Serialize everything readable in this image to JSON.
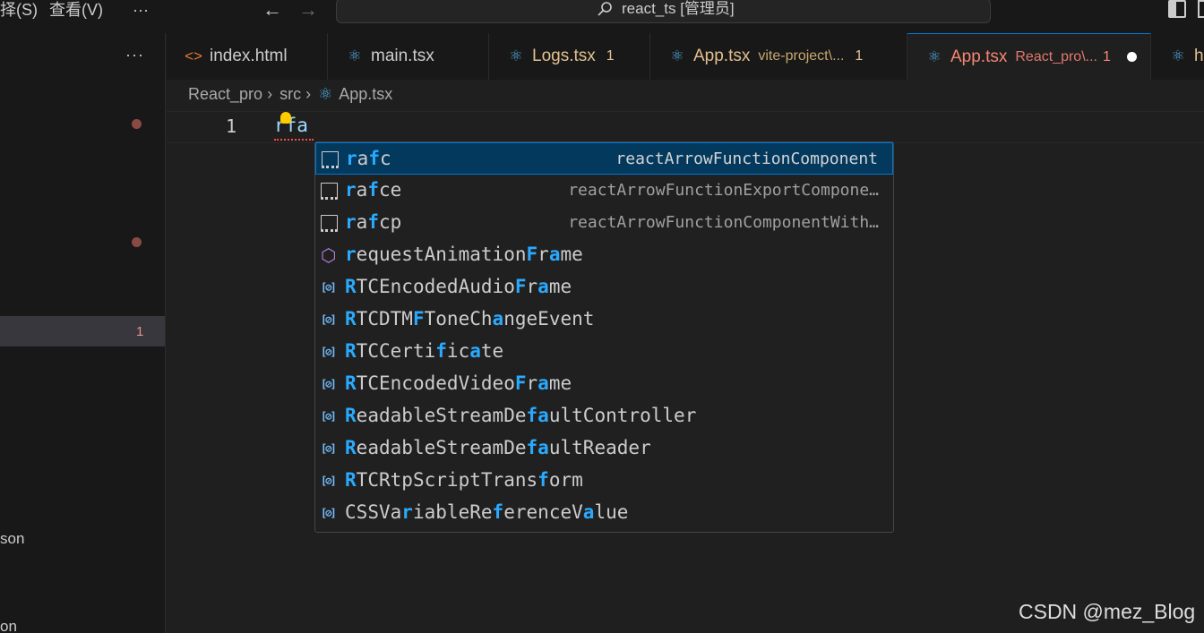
{
  "titlebar": {
    "menu_items": [
      "择(S)",
      "查看(V)",
      "···"
    ],
    "search_text": "react_ts [管理员]"
  },
  "sidebar": {
    "more_label": "···",
    "selected_count": "1",
    "partial_texts": [
      "son",
      "on"
    ]
  },
  "tabs": [
    {
      "icon": "html-icon",
      "label": "index.html",
      "desc": "",
      "badge": "",
      "color": "#cccccc"
    },
    {
      "icon": "react-icon",
      "label": "main.tsx",
      "desc": "",
      "badge": "",
      "color": "#cccccc"
    },
    {
      "icon": "react-icon",
      "label": "Logs.tsx",
      "desc": "",
      "badge": "1",
      "color": "#e2c08d"
    },
    {
      "icon": "react-icon",
      "label": "App.tsx",
      "desc": "vite-project\\...",
      "badge": "1",
      "color": "#e2c08d"
    },
    {
      "icon": "react-icon",
      "label": "App.tsx",
      "desc": "React_pro\\...",
      "badge": "1",
      "color": "#f48771",
      "active": true
    },
    {
      "icon": "react-icon",
      "label": "h",
      "desc": "",
      "badge": "",
      "color": "#e2c08d"
    }
  ],
  "breadcrumb": [
    "React_pro",
    "src",
    "App.tsx"
  ],
  "editor": {
    "line_number": "1",
    "code_text": "rfa"
  },
  "suggestions": [
    {
      "kind": "snippet",
      "label": "rafc",
      "detail": "reactArrowFunctionComponent",
      "selected": true
    },
    {
      "kind": "snippet",
      "label": "rafce",
      "detail": "reactArrowFunctionExportCompone…"
    },
    {
      "kind": "snippet",
      "label": "rafcp",
      "detail": "reactArrowFunctionComponentWith…"
    },
    {
      "kind": "method",
      "label": "requestAnimationFrame",
      "detail": ""
    },
    {
      "kind": "variable",
      "label": "RTCEncodedAudioFrame",
      "detail": ""
    },
    {
      "kind": "variable",
      "label": "RTCDTMFToneChangeEvent",
      "detail": ""
    },
    {
      "kind": "variable",
      "label": "RTCCertificate",
      "detail": ""
    },
    {
      "kind": "variable",
      "label": "RTCEncodedVideoFrame",
      "detail": ""
    },
    {
      "kind": "variable",
      "label": "ReadableStreamDefaultController",
      "detail": ""
    },
    {
      "kind": "variable",
      "label": "ReadableStreamDefaultReader",
      "detail": ""
    },
    {
      "kind": "variable",
      "label": "RTCRtpScriptTransform",
      "detail": ""
    },
    {
      "kind": "variable",
      "label": "CSSVariableReferenceValue",
      "detail": ""
    }
  ],
  "watermark": "CSDN @mez_Blog",
  "colors": {
    "match_highlight": "#2aaaff",
    "selection_bg": "#04395e",
    "accent": "#0078d4"
  }
}
